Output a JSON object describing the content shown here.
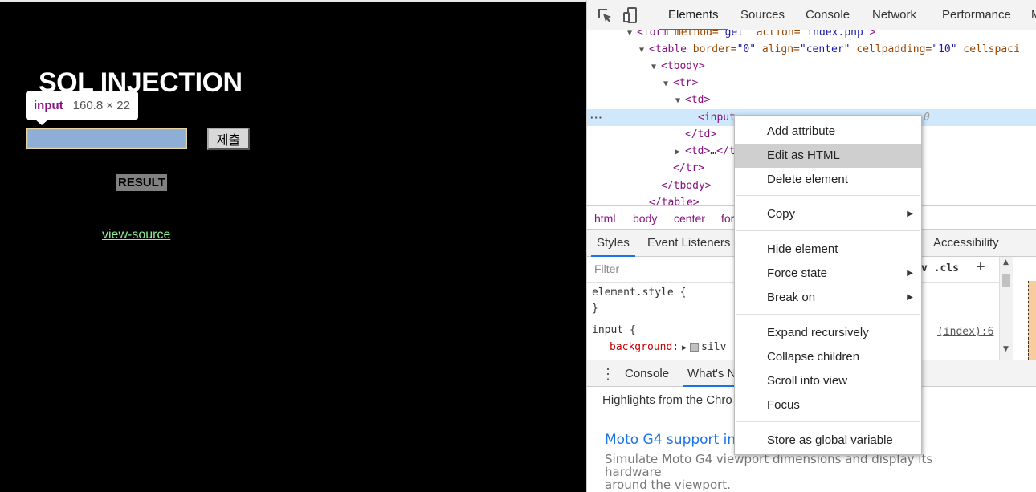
{
  "page": {
    "title": "SQL INJECTION",
    "tooltip": {
      "tag": "input",
      "dimensions": "160.8 × 22"
    },
    "submit_label": "제출",
    "result_label": "RESULT",
    "link_text": "view-source"
  },
  "devtools": {
    "tabs": [
      "Elements",
      "Sources",
      "Console",
      "Network",
      "Performance",
      "M"
    ],
    "active_tab": "Elements",
    "dom": {
      "l0": {
        "tag_open": "<form",
        "a1n": " method=",
        "a1v": "\"get\"",
        "a2n": " action=",
        "a2v": "\"index.php\"",
        "tag_close": ">"
      },
      "l1": {
        "tag_open": "<table",
        "a1n": " border=",
        "a1v": "\"0\"",
        "a2n": " align=",
        "a2v": "\"center\"",
        "a3n": " cellpadding=",
        "a3v": "\"10\"",
        "a4n": " cellspaci"
      },
      "l2": "<tbody>",
      "l3": "<tr>",
      "l4": "<td>",
      "l5": "<input",
      "l5_end": "0",
      "l6": "</td>",
      "l7_open": "<td>",
      "l7_mid": "…",
      "l7_close": "</t",
      "l8": "</tr>",
      "l9": "</tbody>",
      "l10": "</table>"
    },
    "breadcrumb": [
      "html",
      "body",
      "center",
      "for"
    ],
    "style_tabs": [
      "Styles",
      "Event Listeners",
      "Accessibility"
    ],
    "filter_placeholder": "Filter",
    "hov_cls": "v .cls",
    "plus": "+",
    "styles": {
      "element_style": "element.style {",
      "close_brace": "}",
      "input_rule": "input {",
      "prop": "background",
      "colon": ":",
      "value": "silv",
      "source": "(index):6"
    },
    "drawer_tabs": [
      "Console",
      "What's N"
    ],
    "whats_new": {
      "highlights": "Highlights from the Chro",
      "link": "Moto G4 support in D",
      "desc_line1": "Simulate Moto G4 viewport dimensions and display its hardware",
      "desc_line2": "around the viewport."
    }
  },
  "context_menu": {
    "items": [
      "Add attribute",
      "Edit as HTML",
      "Delete element",
      "Copy",
      "Hide element",
      "Force state",
      "Break on",
      "Expand recursively",
      "Collapse children",
      "Scroll into view",
      "Focus",
      "Store as global variable"
    ],
    "hovered": "Edit as HTML"
  }
}
